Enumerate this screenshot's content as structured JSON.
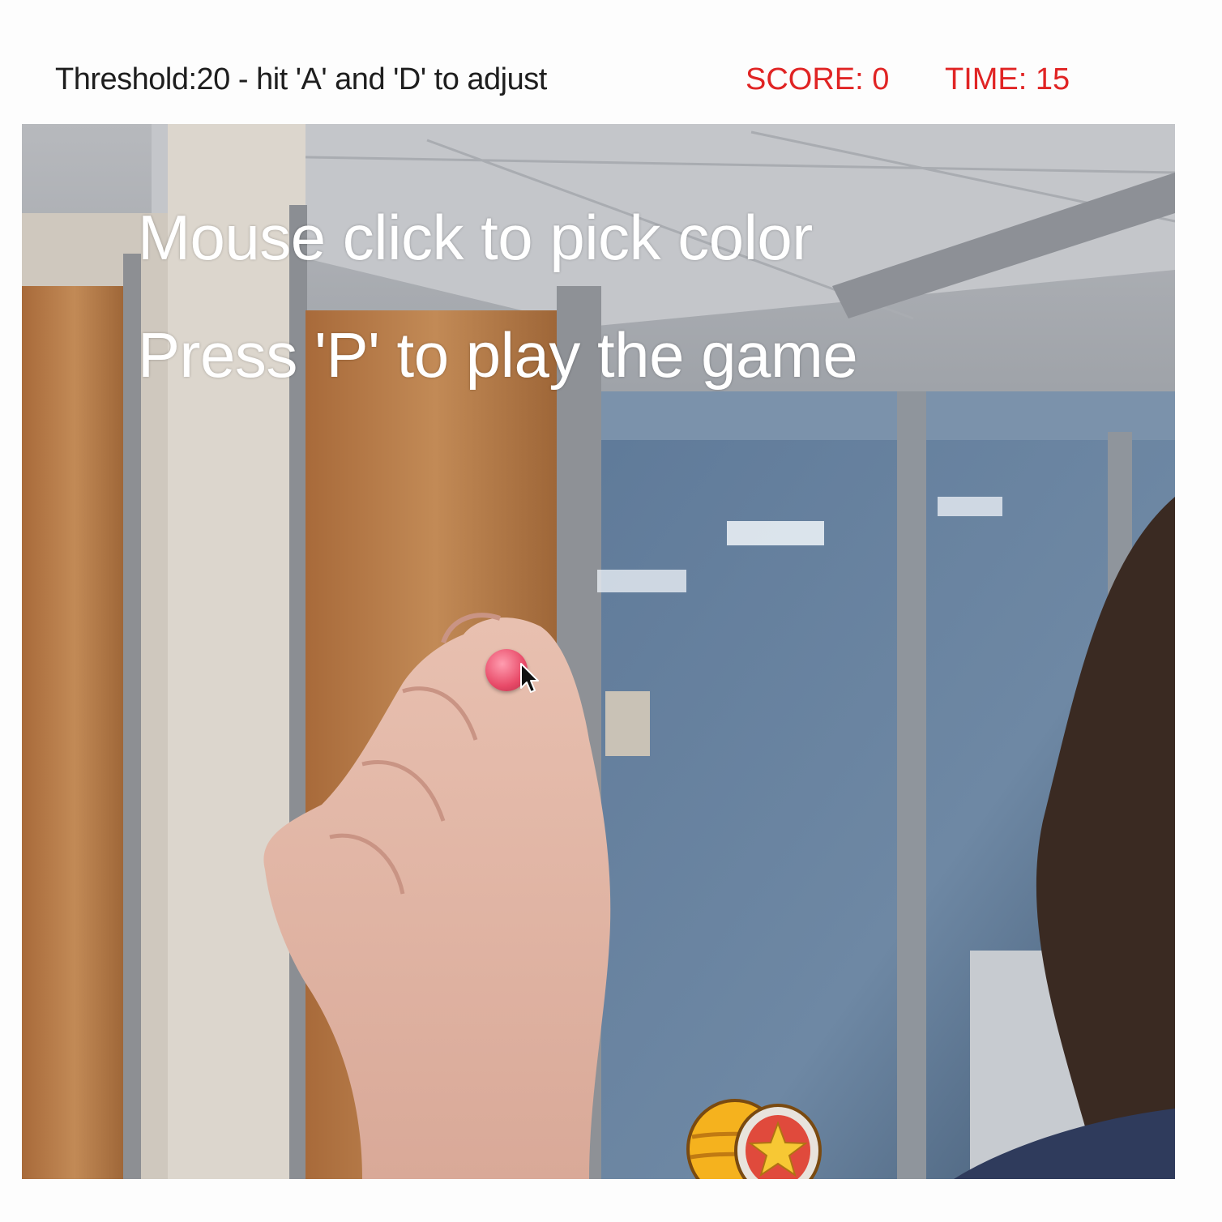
{
  "hud": {
    "threshold_text": "Threshold:20 - hit 'A' and 'D' to adjust",
    "score_text": "SCORE: 0",
    "time_text": "TIME: 15"
  },
  "game": {
    "threshold": 20,
    "score": 0,
    "time": 15
  },
  "overlay": {
    "line1": "Mouse click to pick color",
    "line2": "Press 'P' to play the game"
  },
  "colors": {
    "hud_text": "#1e1e1e",
    "score_time": "#e02424",
    "overlay_text": "#ffffff",
    "target_ball": "#e84a68"
  },
  "icons": {
    "cursor": "mouse-pointer-icon",
    "drum": "drum-icon"
  }
}
